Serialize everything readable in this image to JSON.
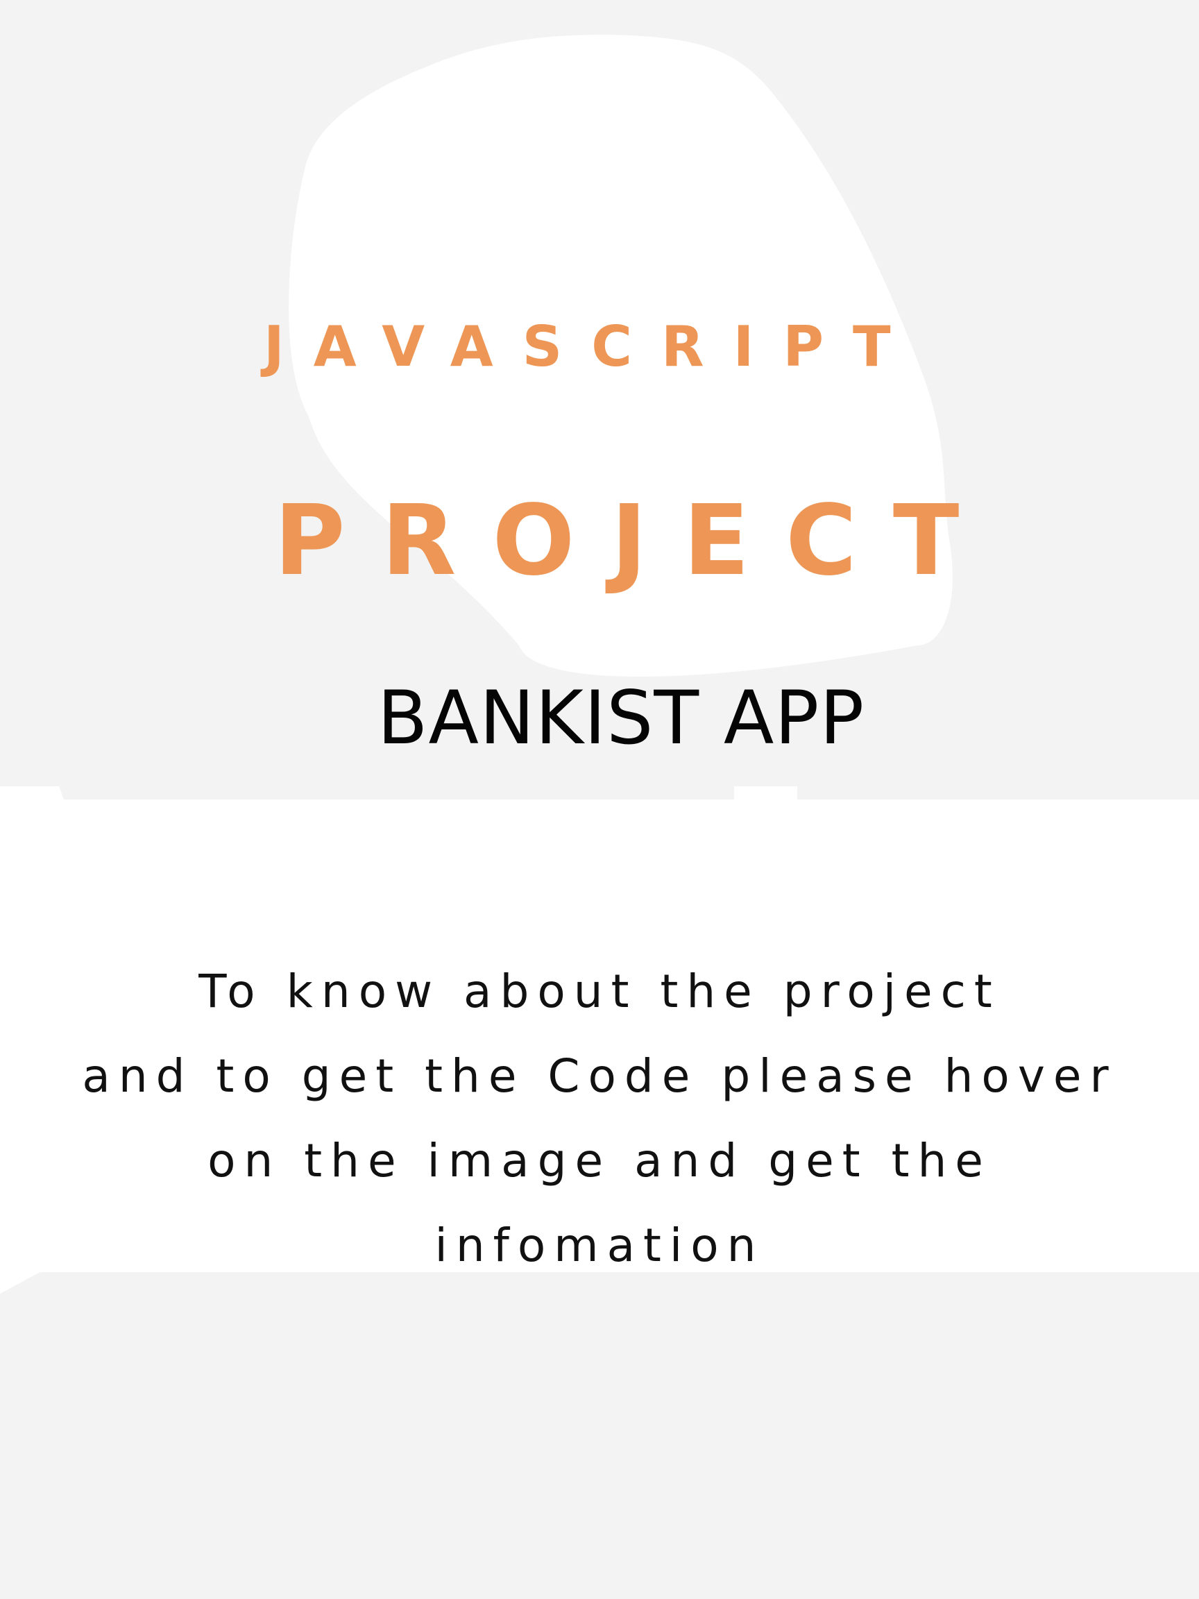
{
  "colors": {
    "page_background": "#f3f3f3",
    "panel": "#ffffff",
    "accent": "#ed9655",
    "text_dark": "#050505"
  },
  "header": {
    "kicker": "JAVASCRIPT",
    "headline": "PROJECT"
  },
  "banner": {
    "title": "BANKIST APP"
  },
  "info": {
    "lines": [
      "To know about the project",
      "and to get the Code please hover",
      "on the image and get the",
      "infomation"
    ]
  }
}
